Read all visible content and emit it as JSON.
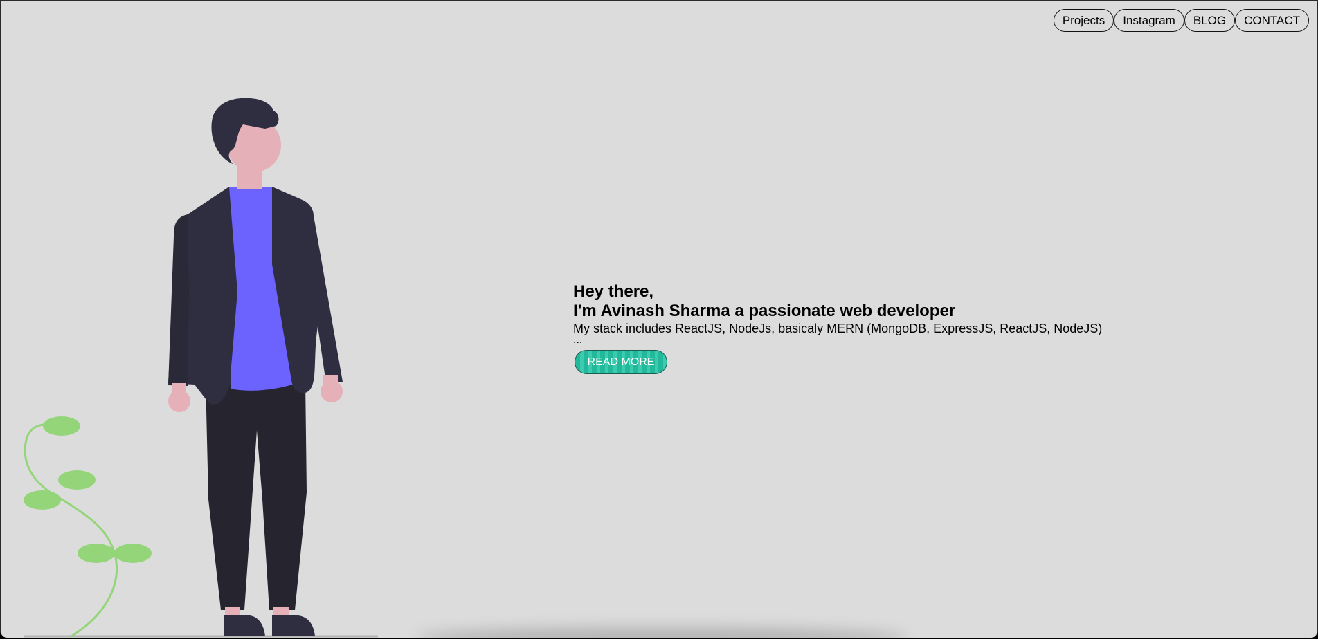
{
  "nav": {
    "items": [
      {
        "label": "Projects"
      },
      {
        "label": "Instagram"
      },
      {
        "label": "BLOG"
      },
      {
        "label": "CONTACT"
      }
    ]
  },
  "hero": {
    "greeting": "Hey there,",
    "intro": "I'm Avinash Sharma a passionate web developer",
    "stack": "My stack includes ReactJS, NodeJs, basicaly MERN (MongoDB, ExpressJS, ReactJS, NodeJS)",
    "ellipsis": "...",
    "cta_label": "READ MORE"
  },
  "colors": {
    "background": "#dcdcdc",
    "accent_shirt": "#6c63ff",
    "suit": "#2f2e41",
    "skin": "#e6b0b8",
    "plant": "#95d57a",
    "button": "#22b89a"
  },
  "icons": {
    "illustration": "man-standing-illustration",
    "plant": "plant-illustration"
  }
}
